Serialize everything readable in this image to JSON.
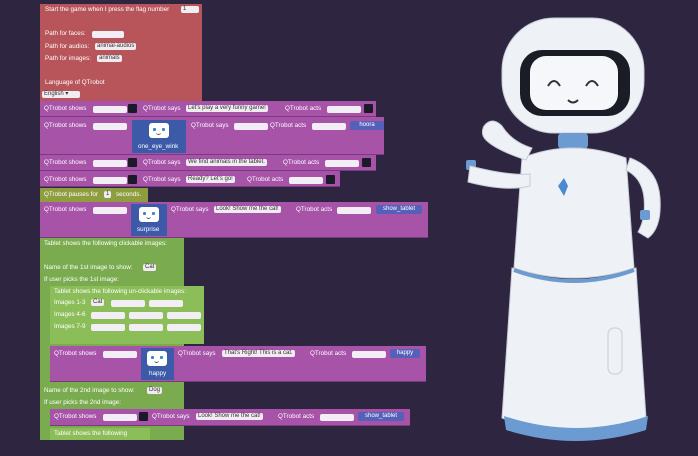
{
  "start": {
    "text": "Start the game when I press the flag number",
    "flag": "1"
  },
  "paths": {
    "faces_label": "Path for faces:",
    "audios_label": "Path for audios:",
    "audios_value": "animal-audios",
    "images_label": "Path for images:",
    "images_value": "animals"
  },
  "language": {
    "label": "Language of QTrobot",
    "value": "English"
  },
  "labels": {
    "qt_shows": "QTrobot shows",
    "qt_says": "QTrobot says",
    "qt_acts": "QTrobot acts",
    "pause_text": "QTrobot pauses for",
    "pause_value": "1",
    "seconds": "seconds."
  },
  "says": {
    "s1": "Let's play a very funny game!",
    "s3": "We find animals in the tablet.",
    "s4": "Ready? Let's go!",
    "s5": "Look! Show me the cat!",
    "s6": "That's Right! This is a cat.",
    "s7": "Look! Show me the cat!"
  },
  "faces": {
    "one_eye_wink": "one_eye_wink",
    "surprise": "surprise",
    "happy": "happy"
  },
  "acts": {
    "hoora": "hoora",
    "show_tablet": "show_tablet",
    "happy": "happy",
    "show_tablet2": "show_tablet"
  },
  "tablet": {
    "clickable": "Tablet shows the following clickable images:",
    "name1": "Name of the 1st image to show:",
    "name1_value": "Cat",
    "picks1": "If user picks the 1st image:",
    "unclickable": "Tablet shows the following un-clickable images:",
    "images_1_3": "Images 1-3",
    "images_1_3_first": "Cat",
    "images_4_6": "Images 4-6",
    "images_7_9": "Images 7-9",
    "name2": "Name of the 2nd image to show:",
    "name2_value": "Dog",
    "picks2": "If user picks the 2nd image:",
    "following": "Tablet shows the following"
  },
  "colors": {
    "event": "#b8555a",
    "robot": "#a653a8",
    "tablet": "#7aab4e",
    "pause": "#8e9e3f",
    "action": "#5560b8",
    "background": "#2e2540"
  },
  "robot_image": {
    "name": "qtrobot-illustration"
  }
}
